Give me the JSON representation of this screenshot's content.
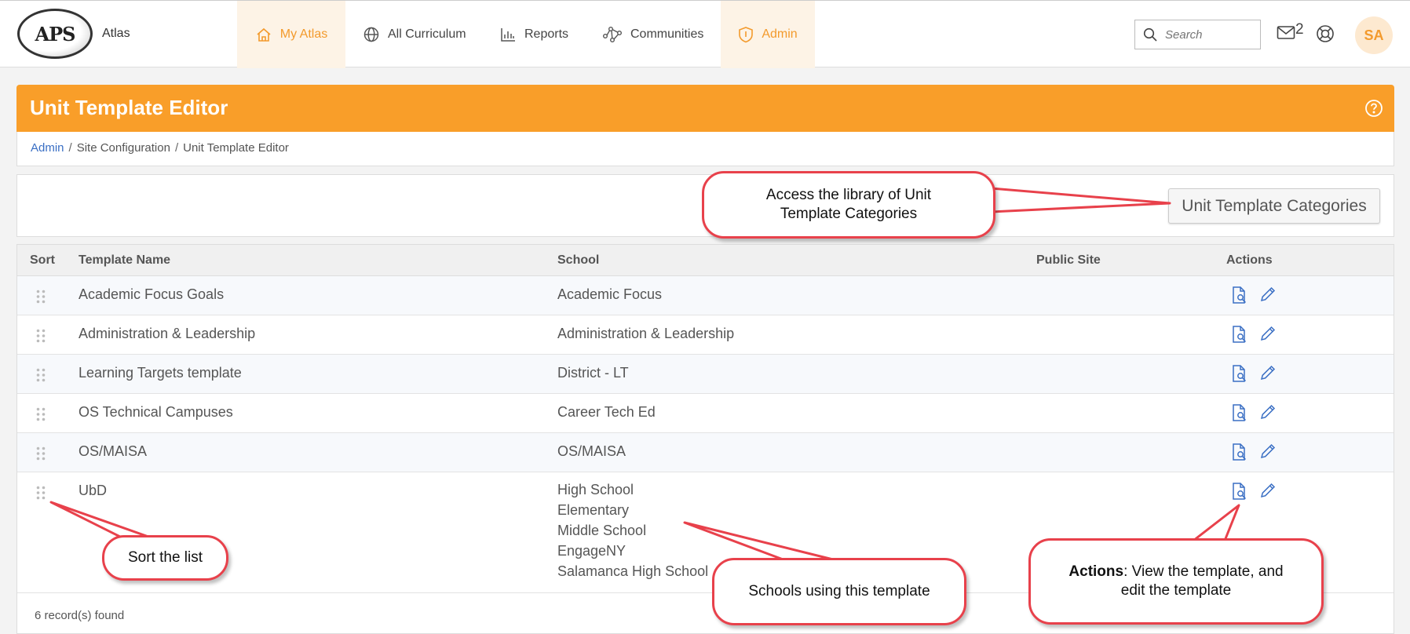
{
  "app": {
    "logo_text": "APS",
    "name": "Atlas"
  },
  "nav": {
    "items": [
      {
        "label": "My Atlas",
        "icon": "home-icon",
        "active": true
      },
      {
        "label": "All Curriculum",
        "icon": "globe-icon",
        "active": false
      },
      {
        "label": "Reports",
        "icon": "bar-chart-icon",
        "active": false
      },
      {
        "label": "Communities",
        "icon": "network-icon",
        "active": false
      },
      {
        "label": "Admin",
        "icon": "shield-icon",
        "active": true
      }
    ],
    "search_placeholder": "Search",
    "mail_count": "2",
    "avatar_initials": "SA"
  },
  "page": {
    "title": "Unit Template Editor",
    "breadcrumb": [
      "Admin",
      "Site Configuration",
      "Unit Template Editor"
    ],
    "categories_button": "Unit Template Categories"
  },
  "table": {
    "headers": {
      "sort": "Sort",
      "name": "Template Name",
      "school": "School",
      "public": "Public Site",
      "actions": "Actions"
    },
    "rows": [
      {
        "name": "Academic Focus Goals",
        "schools": [
          "Academic Focus"
        ]
      },
      {
        "name": "Administration & Leadership",
        "schools": [
          "Administration & Leadership"
        ]
      },
      {
        "name": "Learning Targets template",
        "schools": [
          "District - LT"
        ]
      },
      {
        "name": "OS Technical Campuses",
        "schools": [
          "Career Tech Ed"
        ]
      },
      {
        "name": "OS/MAISA",
        "schools": [
          "OS/MAISA"
        ]
      },
      {
        "name": "UbD",
        "schools": [
          "High School",
          "Elementary",
          "Middle School",
          "EngageNY",
          "Salamanca High School"
        ]
      }
    ],
    "records_found": "6 record(s) found"
  },
  "callouts": {
    "categories_line1": "Access the library of Unit",
    "categories_line2": "Template Categories",
    "sort": "Sort the list",
    "schools": "Schools using this template",
    "actions_bold": "Actions",
    "actions_rest": ": View the template, and",
    "actions_line2": "edit the template"
  },
  "colors": {
    "accent": "#f99e29",
    "link": "#3a6fc4",
    "callout_border": "#e8414b"
  }
}
